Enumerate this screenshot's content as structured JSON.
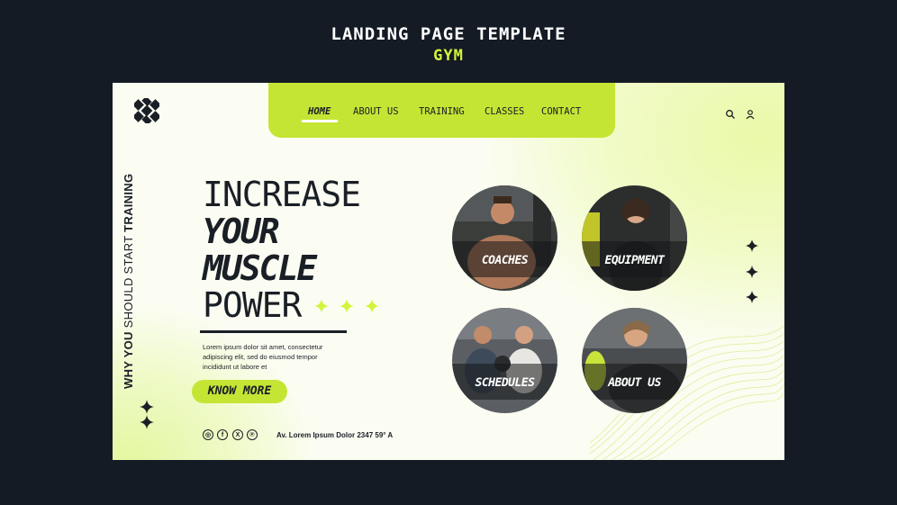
{
  "header": {
    "title": "LANDING PAGE TEMPLATE",
    "subtitle": "GYM"
  },
  "colors": {
    "accent": "#c4e534",
    "dark": "#1a1f26",
    "background": "#141b25"
  },
  "nav": {
    "items": [
      {
        "label": "HOME",
        "active": true
      },
      {
        "label": "ABOUT US",
        "active": false
      },
      {
        "label": "TRAINING",
        "active": false
      },
      {
        "label": "CLASSES",
        "active": false
      },
      {
        "label": "CONTACT",
        "active": false
      }
    ],
    "icons": [
      "search-icon",
      "user-icon"
    ]
  },
  "side_text": {
    "normal": "WHY YOU SHOULD START ",
    "bold": "TRAINING",
    "lead": "WHY YOU"
  },
  "hero": {
    "line1": "INCREASE",
    "line2": "YOUR",
    "line3": "MUSCLE",
    "line4": "POWER",
    "description": "Lorem ipsum dolor sit amet, consectetur adipiscing elit, sed do eiusmod tempor incididunt ut labore et",
    "cta": "KNOW MORE"
  },
  "social": {
    "icons": [
      "instagram-icon",
      "facebook-icon",
      "x-icon",
      "pinterest-icon"
    ],
    "glyphs": [
      "◎",
      "f",
      "X",
      "℗"
    ]
  },
  "address": "Av. Lorem Ipsum Dolor 2347 59° A",
  "cards": [
    {
      "label": "COACHES"
    },
    {
      "label": "EQUIPMENT"
    },
    {
      "label": "SCHEDULES"
    },
    {
      "label": "ABOUT US"
    }
  ]
}
